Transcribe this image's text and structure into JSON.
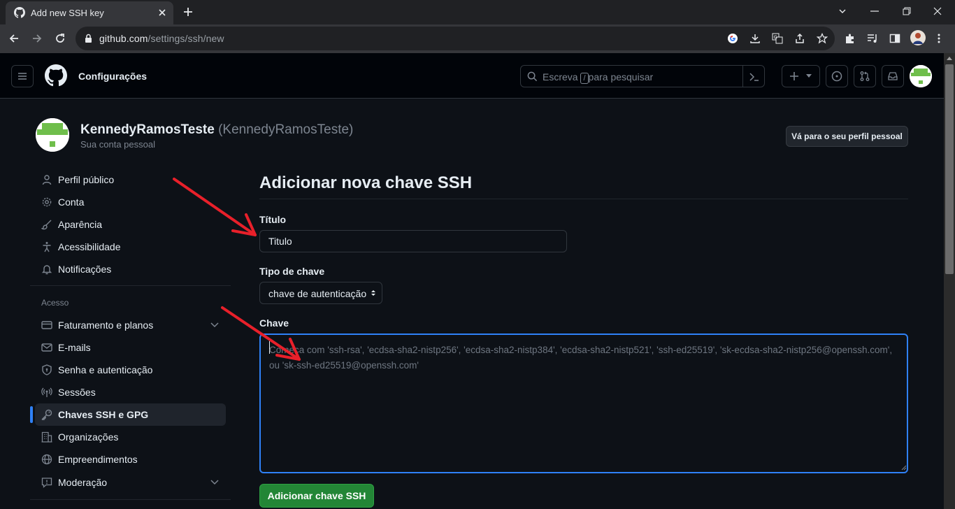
{
  "browser": {
    "tab_title": "Add new SSH key",
    "url_host": "github.com",
    "url_path": "/settings/ssh/new"
  },
  "header": {
    "title": "Configurações",
    "search_before": "Escreva ",
    "search_key": "/",
    "search_after": "para pesquisar"
  },
  "profile": {
    "name": "KennedyRamosTeste",
    "login": "(KennedyRamosTeste)",
    "subtitle": "Sua conta pessoal",
    "go_to_profile": "Vá para o seu perfil pessoal"
  },
  "sidebar": {
    "items": [
      {
        "label": "Perfil público",
        "icon": "person-icon"
      },
      {
        "label": "Conta",
        "icon": "gear-icon"
      },
      {
        "label": "Aparência",
        "icon": "paintbrush-icon"
      },
      {
        "label": "Acessibilidade",
        "icon": "accessibility-icon"
      },
      {
        "label": "Notificações",
        "icon": "bell-icon"
      }
    ],
    "section_label": "Acesso",
    "access_items": [
      {
        "label": "Faturamento e planos",
        "icon": "credit-card-icon"
      },
      {
        "label": "E-mails",
        "icon": "mail-icon"
      },
      {
        "label": "Senha e autenticação",
        "icon": "shield-lock-icon"
      },
      {
        "label": "Sessões",
        "icon": "broadcast-icon"
      },
      {
        "label": "Chaves SSH e GPG",
        "icon": "key-icon"
      },
      {
        "label": "Organizações",
        "icon": "organization-icon"
      },
      {
        "label": "Empreendimentos",
        "icon": "globe-icon"
      },
      {
        "label": "Moderação",
        "icon": "report-icon"
      }
    ]
  },
  "form": {
    "heading": "Adicionar nova chave SSH",
    "title_label": "Título",
    "title_value": "Titulo",
    "type_label": "Tipo de chave",
    "type_value": "chave de autenticação",
    "key_label": "Chave",
    "key_placeholder": "Começa com 'ssh-rsa', 'ecdsa-sha2-nistp256', 'ecdsa-sha2-nistp384', 'ecdsa-sha2-nistp521', 'ssh-ed25519', 'sk-ecdsa-sha2-nistp256@openssh.com', ou 'sk-ssh-ed25519@openssh.com'",
    "submit_label": "Adicionar chave SSH"
  },
  "colors": {
    "accent": "#2f81f7",
    "primary_button": "#238636",
    "annotation_arrow": "#e8202a"
  }
}
